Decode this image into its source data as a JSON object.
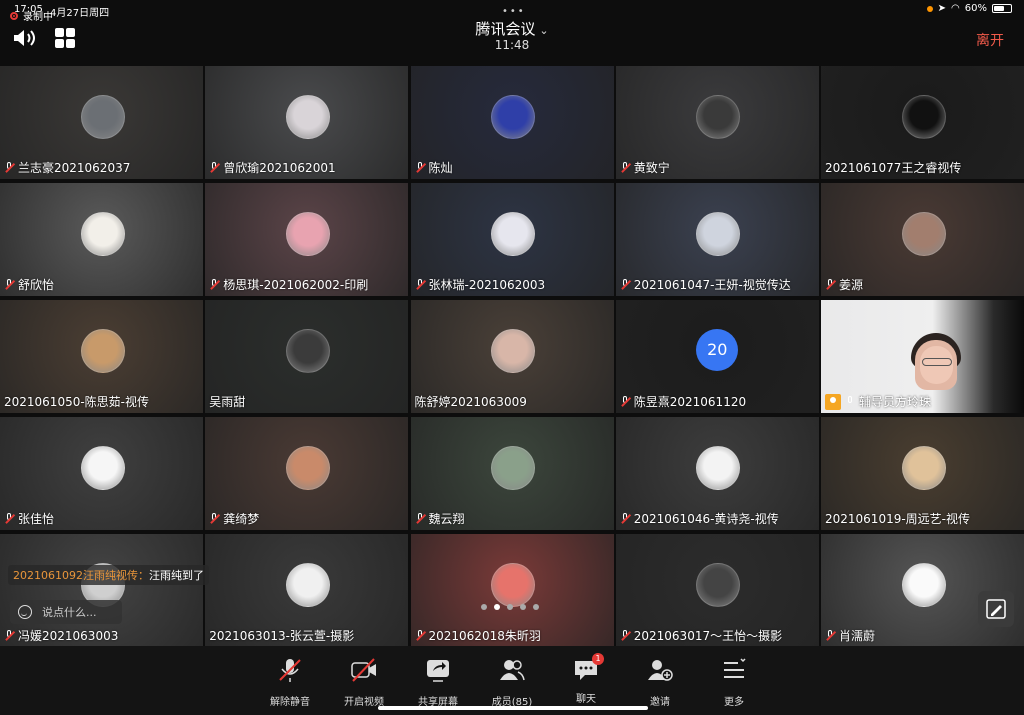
{
  "status_bar": {
    "time": "17:05",
    "date": "4月27日周四",
    "battery": "60%",
    "battery_level": 0.6
  },
  "header": {
    "title": "腾讯会议",
    "timer": "11:48",
    "leave_label": "离开"
  },
  "recording_label": "录制中",
  "participants": [
    {
      "name": "兰志豪2021062037",
      "muted": true,
      "avatar_color": "#6b6f74"
    },
    {
      "name": "曾欣瑜2021062001",
      "muted": true,
      "avatar_color": "#d9d4d8"
    },
    {
      "name": "陈灿",
      "muted": true,
      "avatar_color": "#2f3fa8"
    },
    {
      "name": "黄致宁",
      "muted": true,
      "avatar_color": "#3a3a3a"
    },
    {
      "name": "2021061077王之睿视传",
      "muted": false,
      "avatar_color": "#111111"
    },
    {
      "name": "舒欣怡",
      "muted": true,
      "avatar_color": "#f2efe9"
    },
    {
      "name": "杨思琪-2021062002-印刷",
      "muted": true,
      "avatar_color": "#e8a3b0"
    },
    {
      "name": "张林瑞-2021062003",
      "muted": true,
      "avatar_color": "#e6e6ee"
    },
    {
      "name": "2021061047-王妍-视觉传达",
      "muted": true,
      "avatar_color": "#cfd4de"
    },
    {
      "name": "姜源",
      "muted": true,
      "avatar_color": "#a27e6e"
    },
    {
      "name": "2021061050-陈思茹-视传",
      "muted": false,
      "avatar_color": "#c89a6a"
    },
    {
      "name": "吴雨甜",
      "muted": false,
      "avatar_color": "#3b3b3b"
    },
    {
      "name": "陈舒婷2021063009",
      "muted": false,
      "avatar_color": "#d8b6a8"
    },
    {
      "name": "陈昱熹2021061120",
      "muted": true,
      "avatar_number": "20"
    },
    {
      "name": "辅导员方玲珠",
      "muted": false,
      "video": true
    },
    {
      "name": "张佳怡",
      "muted": true,
      "avatar_color": "#f6f6f6"
    },
    {
      "name": "龚绮梦",
      "muted": true,
      "avatar_color": "#c98a6a"
    },
    {
      "name": "魏云翔",
      "muted": true,
      "avatar_color": "#8aa08a"
    },
    {
      "name": "2021061046-黄诗尧-视传",
      "muted": true,
      "avatar_color": "#f3f3f3"
    },
    {
      "name": "2021061019-周远艺-视传",
      "muted": false,
      "avatar_color": "#e0c29a"
    },
    {
      "name": "冯媛2021063003",
      "muted": true,
      "avatar_color": "#cfcfcf"
    },
    {
      "name": "2021063013-张云萱-摄影",
      "muted": false,
      "avatar_color": "#f0f0f0"
    },
    {
      "name": "2021062018朱昕羽",
      "muted": true,
      "avatar_color": "#e6736b"
    },
    {
      "name": "2021063017～王怡～摄影",
      "muted": true,
      "avatar_color": "#444444"
    },
    {
      "name": "肖濡蔚",
      "muted": true,
      "avatar_color": "#fafafa"
    }
  ],
  "chat": {
    "sender": "2021061092汪雨纯视传：",
    "message": "汪雨纯到了",
    "placeholder": "说点什么..."
  },
  "pager": {
    "pages": 5,
    "current": 2
  },
  "toolbar": {
    "unmute": "解除静音",
    "video": "开启视频",
    "share": "共享屏幕",
    "members": "成员(85)",
    "chat": "聊天",
    "chat_badge": "1",
    "invite": "邀请",
    "more": "更多"
  }
}
